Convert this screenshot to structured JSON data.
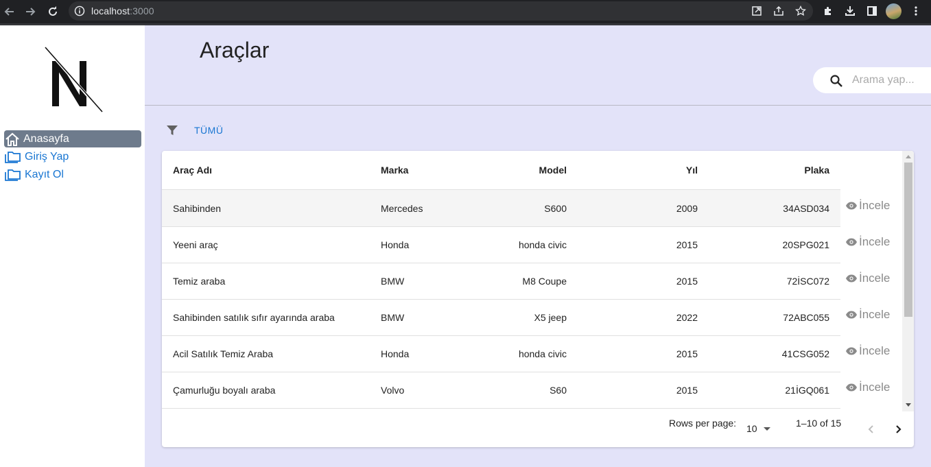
{
  "browser": {
    "url_host": "localhost",
    "url_port": ":3000"
  },
  "sidebar": {
    "items": [
      {
        "label": "Anasayfa",
        "icon": "home-icon",
        "active": true
      },
      {
        "label": "Giriş Yap",
        "icon": "folder-icon",
        "active": false
      },
      {
        "label": "Kayıt Ol",
        "icon": "folder-icon",
        "active": false
      }
    ]
  },
  "header": {
    "title": "Araçlar",
    "search_placeholder": "Arama yap..."
  },
  "filter": {
    "all_label": "TÜMÜ"
  },
  "table": {
    "columns": [
      "Araç Adı",
      "Marka",
      "Model",
      "Yıl",
      "Plaka"
    ],
    "action_label": "İncele",
    "rows": [
      {
        "name": "Sahibinden",
        "brand": "Mercedes",
        "model": "S600",
        "year": "2009",
        "plate": "34ASD034"
      },
      {
        "name": "Yeeni araç",
        "brand": "Honda",
        "model": "honda civic",
        "year": "2015",
        "plate": "20SPG021"
      },
      {
        "name": "Temiz araba",
        "brand": "BMW",
        "model": "M8 Coupe",
        "year": "2015",
        "plate": "72İSC072"
      },
      {
        "name": "Sahibinden satılık sıfır ayarında araba",
        "brand": "BMW",
        "model": "X5 jeep",
        "year": "2022",
        "plate": "72ABC055"
      },
      {
        "name": "Acil Satılık Temiz Araba",
        "brand": "Honda",
        "model": "honda civic",
        "year": "2015",
        "plate": "41CSG052"
      },
      {
        "name": "Çamurluğu boyalı araba",
        "brand": "Volvo",
        "model": "S60",
        "year": "2015",
        "plate": "21İGQ061"
      }
    ]
  },
  "pagination": {
    "rows_per_page_label": "Rows per page:",
    "rows_per_page_value": "10",
    "range_text": "1–10 of 15"
  },
  "colors": {
    "main_bg": "#e3e3f9",
    "active_nav_bg": "#6e7b8c",
    "link": "#1976d2"
  }
}
